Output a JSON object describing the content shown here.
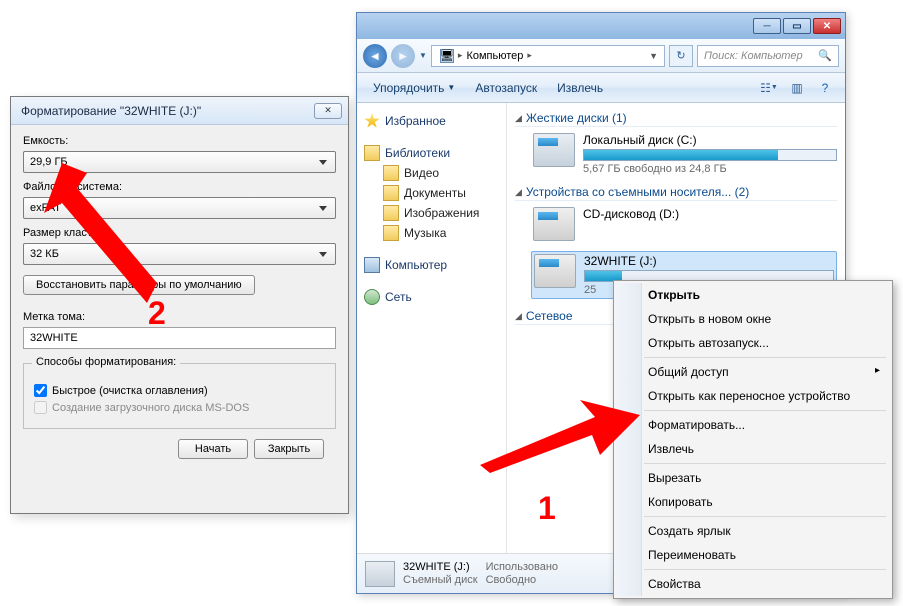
{
  "format_dialog": {
    "title": "Форматирование \"32WHITE (J:)\"",
    "capacity_label": "Емкость:",
    "capacity_value": "29,9 ГБ",
    "fs_label": "Файловая система:",
    "fs_value": "exFAT",
    "cluster_label": "Размер кластера:",
    "cluster_value": "32 КБ",
    "restore_btn": "Восстановить параметры по умолчанию",
    "volume_label": "Метка тома:",
    "volume_value": "32WHITE",
    "options_legend": "Способы форматирования:",
    "quick_check": "Быстрое (очистка оглавления)",
    "msdos_check": "Создание загрузочного диска MS-DOS",
    "start_btn": "Начать",
    "close_btn": "Закрыть"
  },
  "explorer": {
    "breadcrumb": "Компьютер",
    "search_placeholder": "Поиск: Компьютер",
    "toolbar": {
      "organize": "Упорядочить",
      "autorun": "Автозапуск",
      "eject": "Извлечь"
    },
    "nav": {
      "favorites": "Избранное",
      "libraries": "Библиотеки",
      "video": "Видео",
      "documents": "Документы",
      "pictures": "Изображения",
      "music": "Музыка",
      "computer": "Компьютер",
      "network": "Сеть"
    },
    "sections": {
      "hdd_head": "Жесткие диски (1)",
      "local_disk_name": "Локальный диск (C:)",
      "local_disk_sub": "5,67 ГБ свободно из 24,8 ГБ",
      "removable_head": "Устройства со съемными носителя... (2)",
      "cd_name": "CD-дисковод (D:)",
      "usb_name": "32WHITE (J:)",
      "usb_sub": "25",
      "network_head": "Сетевое"
    },
    "statusbar": {
      "name": "32WHITE (J:)",
      "type": "Съемный диск",
      "used_lbl": "Использовано",
      "free_lbl": "Свободно"
    }
  },
  "context_menu": {
    "open": "Открыть",
    "open_new": "Открыть в новом окне",
    "open_autorun": "Открыть автозапуск...",
    "share": "Общий доступ",
    "portable": "Открыть как переносное устройство",
    "format": "Форматировать...",
    "eject": "Извлечь",
    "cut": "Вырезать",
    "copy": "Копировать",
    "shortcut": "Создать ярлык",
    "rename": "Переименовать",
    "properties": "Свойства"
  },
  "annotations": {
    "one": "1",
    "two": "2"
  }
}
